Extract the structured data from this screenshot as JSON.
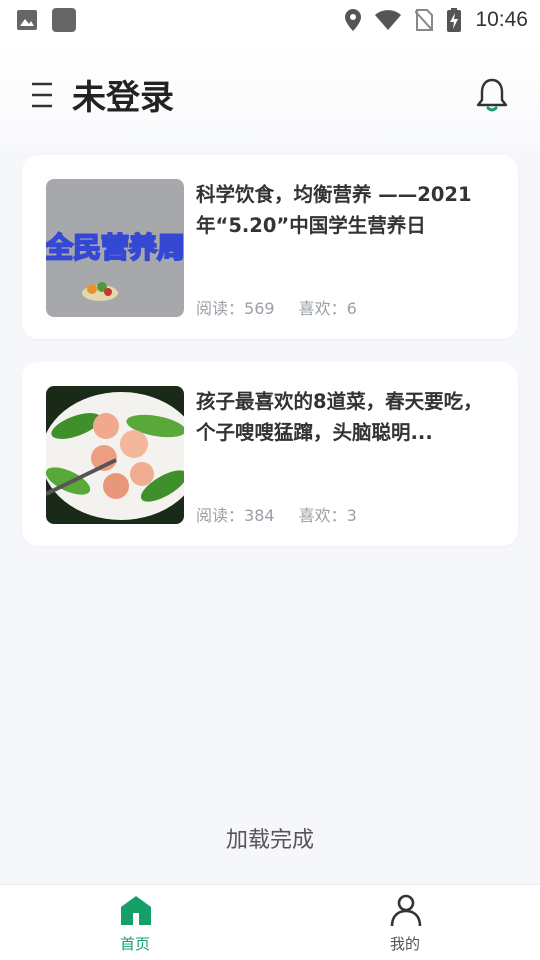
{
  "status_bar": {
    "time": "10:46",
    "left_icons": [
      "gallery-icon",
      "app-icon"
    ],
    "right_icons": [
      "location-icon",
      "wifi-icon",
      "no-sim-icon",
      "battery-charging-icon"
    ]
  },
  "header": {
    "title": "未登录",
    "menu_icon": "menu-icon",
    "bell_icon": "bell-icon"
  },
  "articles": [
    {
      "title": "科学饮食，均衡营养 ——2021年“5.20”中国学生营养日",
      "thumb_text": "全民营养周",
      "reads_label": "阅读：",
      "reads": "569",
      "likes_label": "喜欢：",
      "likes": "6"
    },
    {
      "title": "孩子最喜欢的8道菜，春天要吃，个子嗖嗖猛蹿，头脑聪明...",
      "reads_label": "阅读：",
      "reads": "384",
      "likes_label": "喜欢：",
      "likes": "3"
    }
  ],
  "list_footer": "加载完成",
  "tabbar": {
    "tabs": [
      {
        "label": "首页",
        "icon": "home-icon",
        "active": true
      },
      {
        "label": "我的",
        "icon": "person-icon",
        "active": false
      }
    ],
    "active_color": "#15a06a",
    "inactive_color": "#555555"
  }
}
